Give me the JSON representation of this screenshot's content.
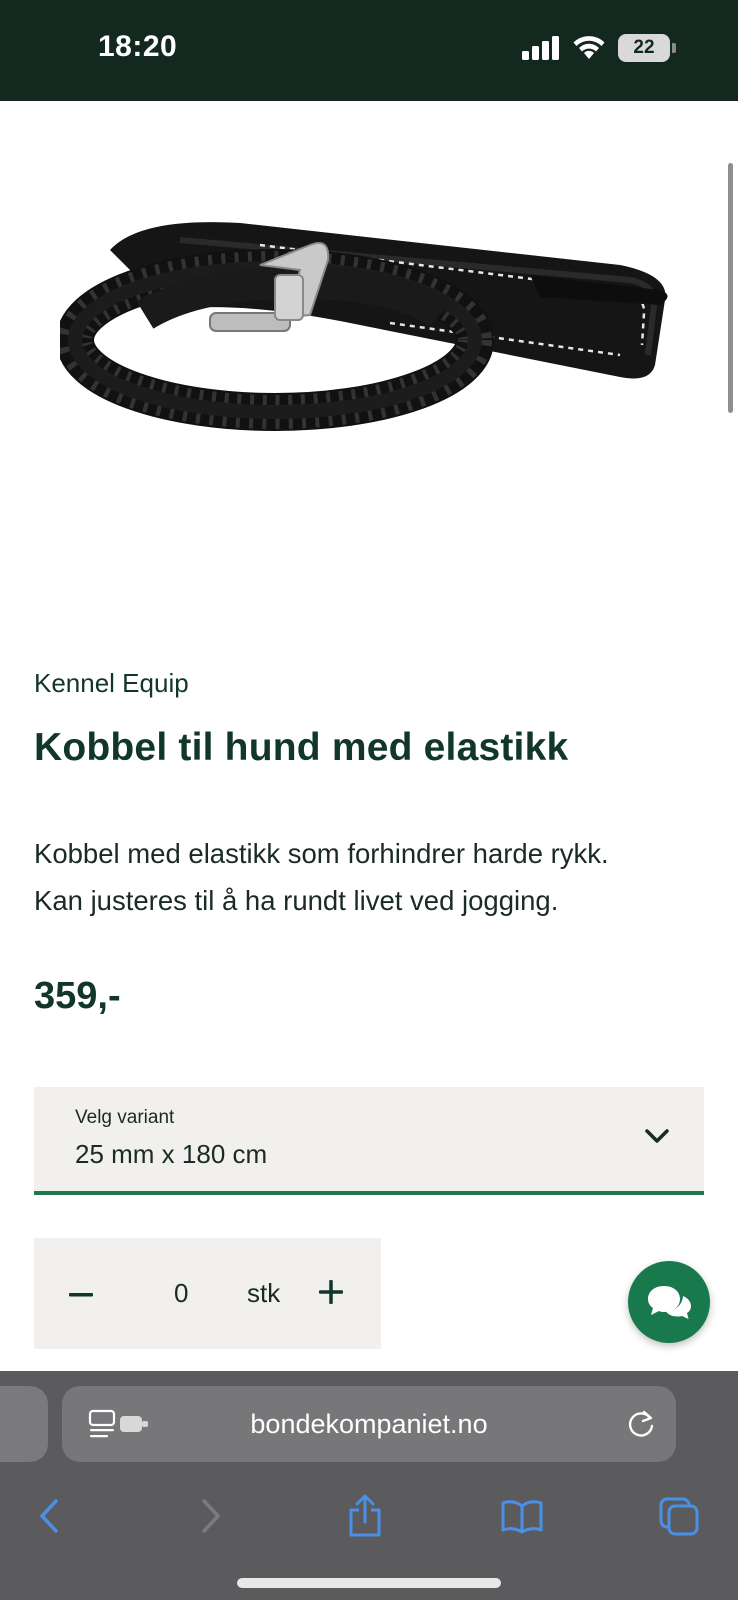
{
  "status_bar": {
    "time": "18:20",
    "battery_level": "22",
    "icons": [
      "cellular-signal-icon",
      "wifi-icon",
      "battery-icon"
    ]
  },
  "product": {
    "image_alt_icon": "dog-leash-image",
    "brand": "Kennel Equip",
    "title": "Kobbel til hund med elastikk",
    "description_line1": "Kobbel med elastikk som forhindrer harde rykk.",
    "description_line2": "Kan justeres til å ha rundt livet ved jogging.",
    "price": "359,-"
  },
  "variant": {
    "label": "Velg variant",
    "selected": "25 mm x 180 cm"
  },
  "quantity": {
    "value": "0",
    "unit": "stk"
  },
  "browser": {
    "url": "bondekompaniet.no",
    "nav_icons": [
      "back-icon",
      "forward-icon",
      "share-icon",
      "bookmarks-icon",
      "tabs-icon"
    ]
  },
  "colors": {
    "status_bar_bg": "#13291f",
    "brand_green": "#187a4c",
    "text_dark_green": "#11362a",
    "field_bg": "#f1f0ee",
    "safari_bar_bg": "#5b5b5d",
    "safari_accent": "#4a90e8"
  }
}
